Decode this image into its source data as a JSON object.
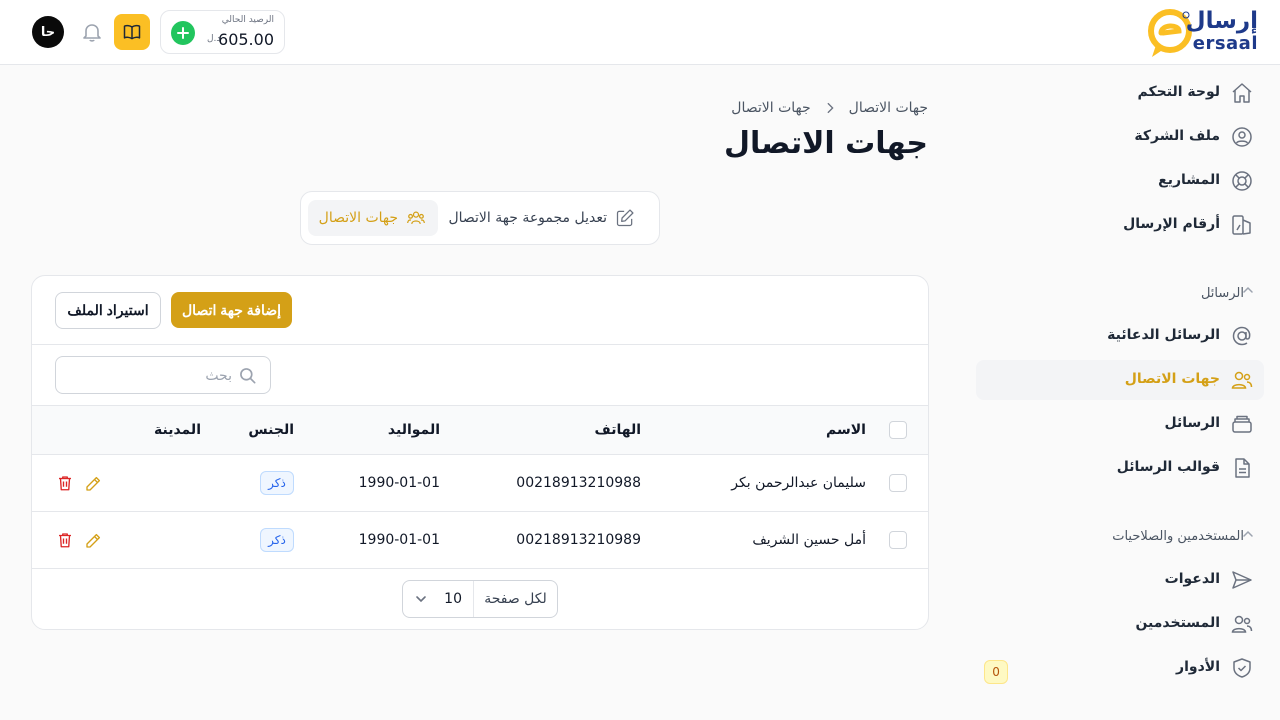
{
  "brand": {
    "name_ar": "إرسال",
    "name_en": "ersaal",
    "colors": {
      "primary": "#d4a017",
      "accent_yellow": "#fbbf24",
      "navy": "#1e3a8a",
      "success": "#22c55e",
      "danger": "#dc2626"
    }
  },
  "header": {
    "avatar_initials": "حا",
    "balance_label": "الرصيد الحالي",
    "balance_value": "605.00",
    "balance_currency": "د.ل",
    "icons": [
      "add-circle-icon",
      "book-open-icon",
      "bell-icon"
    ]
  },
  "sidebar": {
    "top_items": [
      {
        "label": "لوحة التحكم",
        "icon": "home-icon"
      },
      {
        "label": "ملف الشركة",
        "icon": "user-circle-icon"
      },
      {
        "label": "المشاريع",
        "icon": "lifebuoy-icon"
      },
      {
        "label": "أرقام الإرسال",
        "icon": "sender-numbers-icon"
      }
    ],
    "messages_section": {
      "title": "الرسائل",
      "items": [
        {
          "label": "الرسائل الدعائية",
          "icon": "at-sign-icon"
        },
        {
          "label": "جهات الاتصال",
          "icon": "users-icon",
          "active": true
        },
        {
          "label": "الرسائل",
          "icon": "inbox-stack-icon"
        },
        {
          "label": "قوالب الرسائل",
          "icon": "document-text-icon"
        }
      ]
    },
    "users_section": {
      "title": "المستخدمين والصلاحيات",
      "items": [
        {
          "label": "الدعوات",
          "icon": "send-icon"
        },
        {
          "label": "المستخدمين",
          "icon": "users-icon"
        },
        {
          "label": "الأدوار",
          "icon": "shield-check-icon",
          "badge": "0"
        }
      ]
    }
  },
  "main": {
    "breadcrumb": [
      "جهات الاتصال",
      "جهات الاتصال"
    ],
    "title": "جهات الاتصال",
    "tabs": [
      {
        "label": "جهات الاتصال",
        "icon": "user-group-icon",
        "active": true
      },
      {
        "label": "تعديل مجموعة جهة الاتصال",
        "icon": "pencil-square-icon"
      }
    ],
    "toolbar": {
      "add_label": "إضافة جهة اتصال",
      "import_label": "استيراد الملف"
    },
    "search": {
      "placeholder": "بحث",
      "value": ""
    },
    "table": {
      "columns": [
        "الاسم",
        "الهاتف",
        "المواليد",
        "الجنس",
        "المدينة"
      ],
      "rows": [
        {
          "name": "سليمان عبدالرحمن بكر",
          "phone": "00218913210988",
          "dob": "1990-01-01",
          "gender": "ذكر",
          "city": ""
        },
        {
          "name": "أمل حسين الشريف",
          "phone": "00218913210989",
          "dob": "1990-01-01",
          "gender": "ذكر",
          "city": ""
        }
      ]
    },
    "pagination": {
      "per_page_label": "لكل صفحة",
      "per_page_value": "10"
    }
  }
}
